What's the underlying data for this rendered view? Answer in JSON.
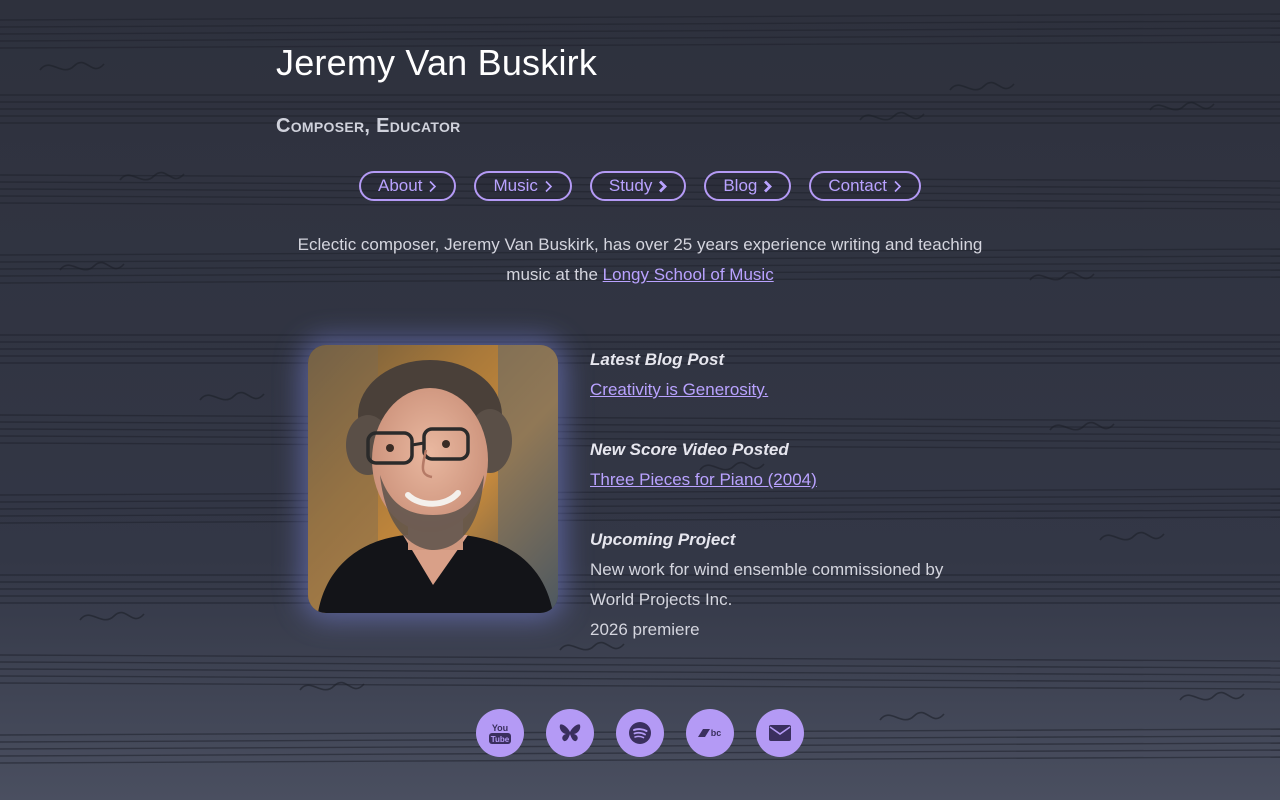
{
  "header": {
    "title": "Jeremy Van Buskirk",
    "subtitle": "Composer, Educator"
  },
  "nav": {
    "items": [
      {
        "label": "About"
      },
      {
        "label": "Music"
      },
      {
        "label": "Study"
      },
      {
        "label": "Blog"
      },
      {
        "label": "Contact"
      }
    ]
  },
  "intro": {
    "text": "Eclectic composer, Jeremy Van Buskirk, has over 25 years experience writing and teaching music at the ",
    "link_text": "Longy School of Music"
  },
  "news": {
    "blog_heading": "Latest Blog Post",
    "blog_link": "Creativity is Generosity.",
    "video_heading": "New Score Video Posted",
    "video_link": "Three Pieces for Piano (2004)",
    "project_heading": "Upcoming Project",
    "project_lines": [
      "New work for wind ensemble commissioned by",
      "World Projects Inc.",
      "2026 premiere"
    ]
  },
  "socials": {
    "youtube_label": "You Tube",
    "icons": [
      "youtube-icon",
      "bluesky-icon",
      "spotify-icon",
      "bandcamp-icon",
      "email-icon"
    ]
  },
  "colors": {
    "accent": "#b49af5",
    "link": "#b9a2ff",
    "background": "#30333f"
  }
}
